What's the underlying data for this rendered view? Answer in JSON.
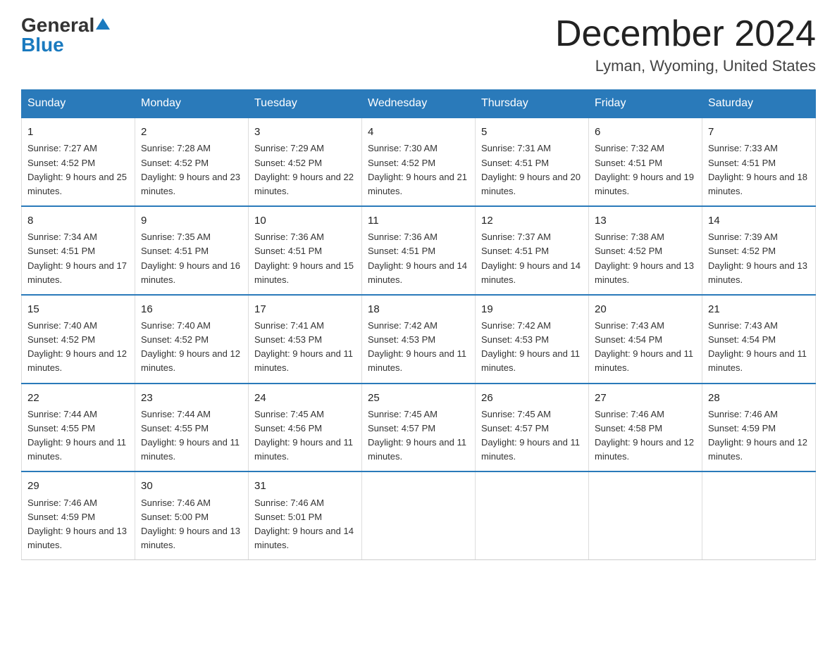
{
  "header": {
    "logo_general": "General",
    "logo_blue": "Blue",
    "month_title": "December 2024",
    "location": "Lyman, Wyoming, United States"
  },
  "weekdays": [
    "Sunday",
    "Monday",
    "Tuesday",
    "Wednesday",
    "Thursday",
    "Friday",
    "Saturday"
  ],
  "weeks": [
    [
      {
        "day": "1",
        "sunrise": "7:27 AM",
        "sunset": "4:52 PM",
        "daylight": "9 hours and 25 minutes."
      },
      {
        "day": "2",
        "sunrise": "7:28 AM",
        "sunset": "4:52 PM",
        "daylight": "9 hours and 23 minutes."
      },
      {
        "day": "3",
        "sunrise": "7:29 AM",
        "sunset": "4:52 PM",
        "daylight": "9 hours and 22 minutes."
      },
      {
        "day": "4",
        "sunrise": "7:30 AM",
        "sunset": "4:52 PM",
        "daylight": "9 hours and 21 minutes."
      },
      {
        "day": "5",
        "sunrise": "7:31 AM",
        "sunset": "4:51 PM",
        "daylight": "9 hours and 20 minutes."
      },
      {
        "day": "6",
        "sunrise": "7:32 AM",
        "sunset": "4:51 PM",
        "daylight": "9 hours and 19 minutes."
      },
      {
        "day": "7",
        "sunrise": "7:33 AM",
        "sunset": "4:51 PM",
        "daylight": "9 hours and 18 minutes."
      }
    ],
    [
      {
        "day": "8",
        "sunrise": "7:34 AM",
        "sunset": "4:51 PM",
        "daylight": "9 hours and 17 minutes."
      },
      {
        "day": "9",
        "sunrise": "7:35 AM",
        "sunset": "4:51 PM",
        "daylight": "9 hours and 16 minutes."
      },
      {
        "day": "10",
        "sunrise": "7:36 AM",
        "sunset": "4:51 PM",
        "daylight": "9 hours and 15 minutes."
      },
      {
        "day": "11",
        "sunrise": "7:36 AM",
        "sunset": "4:51 PM",
        "daylight": "9 hours and 14 minutes."
      },
      {
        "day": "12",
        "sunrise": "7:37 AM",
        "sunset": "4:51 PM",
        "daylight": "9 hours and 14 minutes."
      },
      {
        "day": "13",
        "sunrise": "7:38 AM",
        "sunset": "4:52 PM",
        "daylight": "9 hours and 13 minutes."
      },
      {
        "day": "14",
        "sunrise": "7:39 AM",
        "sunset": "4:52 PM",
        "daylight": "9 hours and 13 minutes."
      }
    ],
    [
      {
        "day": "15",
        "sunrise": "7:40 AM",
        "sunset": "4:52 PM",
        "daylight": "9 hours and 12 minutes."
      },
      {
        "day": "16",
        "sunrise": "7:40 AM",
        "sunset": "4:52 PM",
        "daylight": "9 hours and 12 minutes."
      },
      {
        "day": "17",
        "sunrise": "7:41 AM",
        "sunset": "4:53 PM",
        "daylight": "9 hours and 11 minutes."
      },
      {
        "day": "18",
        "sunrise": "7:42 AM",
        "sunset": "4:53 PM",
        "daylight": "9 hours and 11 minutes."
      },
      {
        "day": "19",
        "sunrise": "7:42 AM",
        "sunset": "4:53 PM",
        "daylight": "9 hours and 11 minutes."
      },
      {
        "day": "20",
        "sunrise": "7:43 AM",
        "sunset": "4:54 PM",
        "daylight": "9 hours and 11 minutes."
      },
      {
        "day": "21",
        "sunrise": "7:43 AM",
        "sunset": "4:54 PM",
        "daylight": "9 hours and 11 minutes."
      }
    ],
    [
      {
        "day": "22",
        "sunrise": "7:44 AM",
        "sunset": "4:55 PM",
        "daylight": "9 hours and 11 minutes."
      },
      {
        "day": "23",
        "sunrise": "7:44 AM",
        "sunset": "4:55 PM",
        "daylight": "9 hours and 11 minutes."
      },
      {
        "day": "24",
        "sunrise": "7:45 AM",
        "sunset": "4:56 PM",
        "daylight": "9 hours and 11 minutes."
      },
      {
        "day": "25",
        "sunrise": "7:45 AM",
        "sunset": "4:57 PM",
        "daylight": "9 hours and 11 minutes."
      },
      {
        "day": "26",
        "sunrise": "7:45 AM",
        "sunset": "4:57 PM",
        "daylight": "9 hours and 11 minutes."
      },
      {
        "day": "27",
        "sunrise": "7:46 AM",
        "sunset": "4:58 PM",
        "daylight": "9 hours and 12 minutes."
      },
      {
        "day": "28",
        "sunrise": "7:46 AM",
        "sunset": "4:59 PM",
        "daylight": "9 hours and 12 minutes."
      }
    ],
    [
      {
        "day": "29",
        "sunrise": "7:46 AM",
        "sunset": "4:59 PM",
        "daylight": "9 hours and 13 minutes."
      },
      {
        "day": "30",
        "sunrise": "7:46 AM",
        "sunset": "5:00 PM",
        "daylight": "9 hours and 13 minutes."
      },
      {
        "day": "31",
        "sunrise": "7:46 AM",
        "sunset": "5:01 PM",
        "daylight": "9 hours and 14 minutes."
      },
      {
        "day": "",
        "sunrise": "",
        "sunset": "",
        "daylight": ""
      },
      {
        "day": "",
        "sunrise": "",
        "sunset": "",
        "daylight": ""
      },
      {
        "day": "",
        "sunrise": "",
        "sunset": "",
        "daylight": ""
      },
      {
        "day": "",
        "sunrise": "",
        "sunset": "",
        "daylight": ""
      }
    ]
  ],
  "labels": {
    "sunrise": "Sunrise: ",
    "sunset": "Sunset: ",
    "daylight": "Daylight: "
  }
}
